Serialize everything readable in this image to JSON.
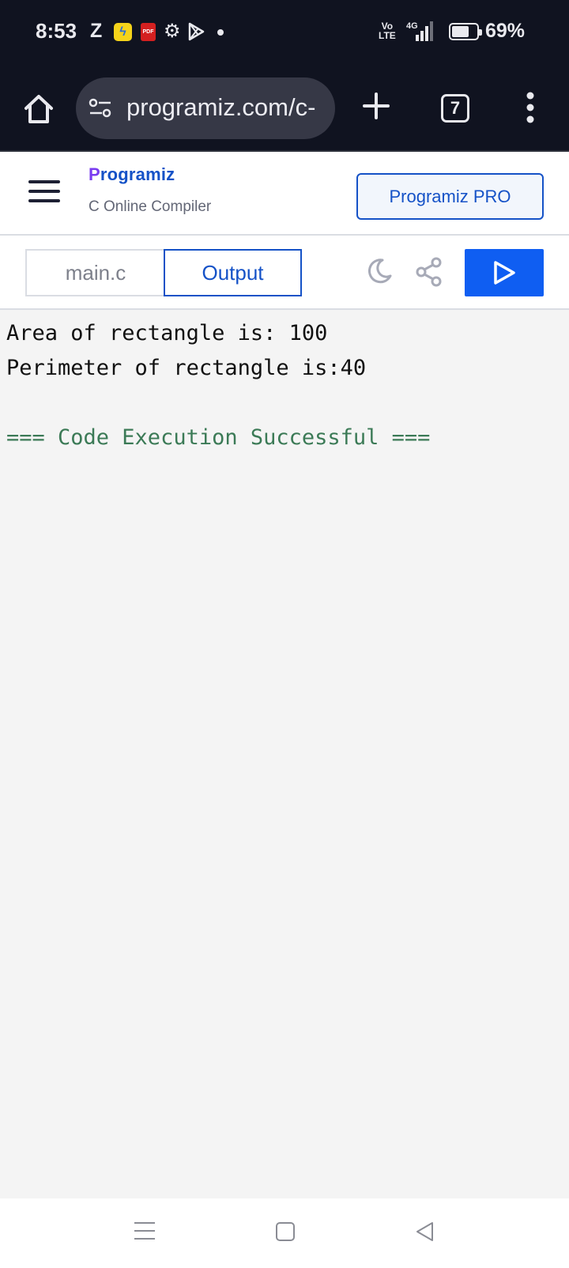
{
  "status_bar": {
    "time": "8:53",
    "notif_letter": "Z",
    "volte": "Vo LTE",
    "network": "4G",
    "battery_pct": "69%",
    "battery_level": 0.69,
    "icons": [
      "flipkart-icon",
      "pdf-icon",
      "gear-icon",
      "play-store-icon",
      "dot-icon"
    ]
  },
  "browser": {
    "url": "programiz.com/c-",
    "tab_count": "7",
    "icons": [
      "home-icon",
      "site-settings-icon",
      "plus-icon",
      "tab-switcher-icon",
      "overflow-menu-icon"
    ]
  },
  "header": {
    "logo_text": "rogramiz",
    "logo_mark": "P",
    "subtitle": "C Online Compiler",
    "pro_button": "Programiz PRO"
  },
  "tabs": {
    "file_tab": "main.c",
    "output_tab": "Output",
    "active": "Output"
  },
  "output": {
    "lines": [
      "Area of rectangle is: 100",
      "Perimeter of rectangle is:40",
      "",
      "=== Code Execution Successful ==="
    ]
  },
  "colors": {
    "status_bg": "#101320",
    "brand_blue": "#1552c7",
    "run_blue": "#0f5ef2",
    "success_green": "#3b7a56",
    "output_bg": "#f4f4f4"
  }
}
